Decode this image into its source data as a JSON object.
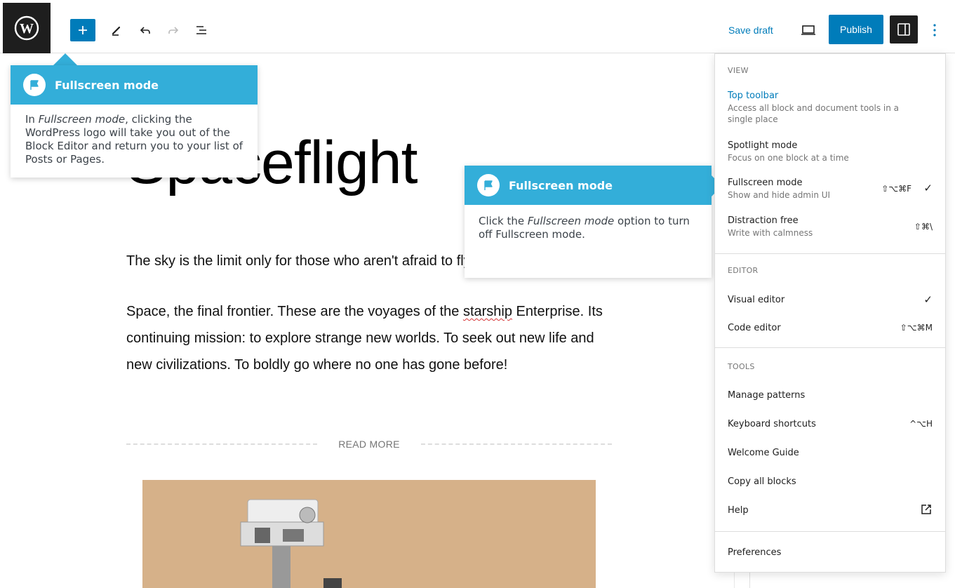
{
  "toolbar": {
    "save_draft": "Save draft",
    "publish": "Publish"
  },
  "post": {
    "title": "Spaceflight",
    "p1": "The sky is the limit only for those who aren't afraid to fly!",
    "p2_before": "Space, the final frontier. These are the voyages of the ",
    "p2_misspelled": "starship",
    "p2_after": " Enterprise. Its continuing mission: to explore strange new worlds. To seek out new life and new civilizations. To boldly go where no one has gone before!",
    "read_more": "READ MORE"
  },
  "tooltip1": {
    "title": "Fullscreen mode",
    "body_pre": "In ",
    "body_em": "Fullscreen mode",
    "body_post": ", clicking the WordPress logo will take you out of the Block Editor and return you to your list of Posts or Pages."
  },
  "tooltip2": {
    "title": "Fullscreen mode",
    "body_pre": "Click the ",
    "body_em": "Fullscreen mode",
    "body_post": " option to turn off Fullscreen mode."
  },
  "menu": {
    "view_label": "VIEW",
    "top_toolbar": {
      "label": "Top toolbar",
      "desc": "Access all block and document tools in a single place"
    },
    "spotlight": {
      "label": "Spotlight mode",
      "desc": "Focus on one block at a time"
    },
    "fullscreen": {
      "label": "Fullscreen mode",
      "desc": "Show and hide admin UI",
      "shortcut": "⇧⌥⌘F",
      "check": "✓"
    },
    "distraction": {
      "label": "Distraction free",
      "desc": "Write with calmness",
      "shortcut": "⇧⌘\\"
    },
    "editor_label": "EDITOR",
    "visual": {
      "label": "Visual editor",
      "check": "✓"
    },
    "code": {
      "label": "Code editor",
      "shortcut": "⇧⌥⌘M"
    },
    "tools_label": "TOOLS",
    "manage_patterns": "Manage patterns",
    "keyboard": {
      "label": "Keyboard shortcuts",
      "shortcut": "^⌥H"
    },
    "welcome": "Welcome Guide",
    "copy_all": "Copy all blocks",
    "help": "Help",
    "preferences": "Preferences"
  },
  "colors": {
    "accent": "#007cba",
    "tooltip_header": "#33aed9",
    "dark": "#1e1e1e"
  }
}
